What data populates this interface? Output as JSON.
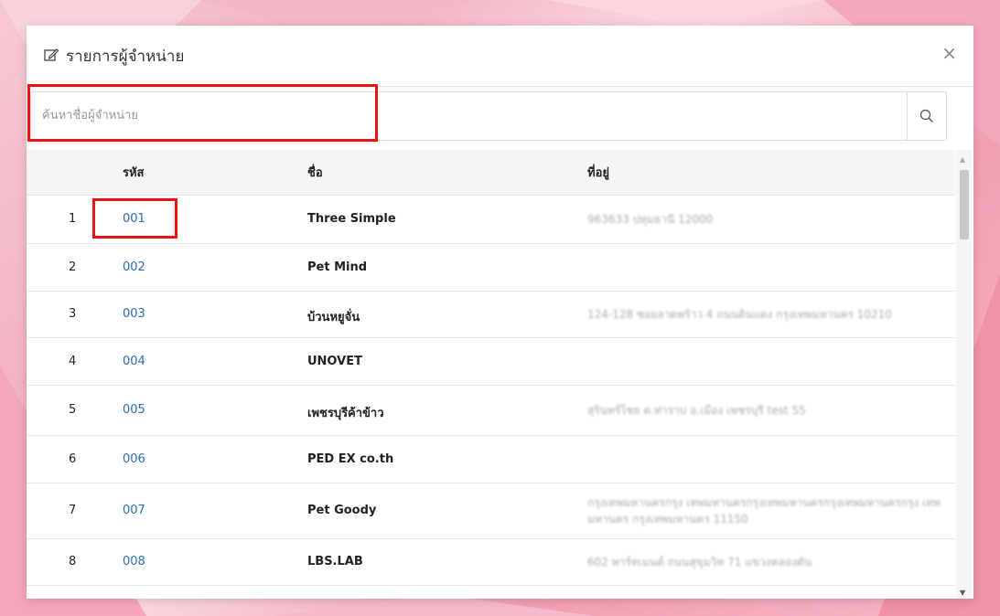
{
  "dialog": {
    "title": "รายการผู้จำหน่าย",
    "close_label": "×"
  },
  "search": {
    "placeholder": "ค้นหาชื่อผู้จำหน่าย",
    "value": ""
  },
  "table": {
    "headers": {
      "code": "รหัส",
      "name": "ชื่อ",
      "address": "ที่อยู่"
    },
    "rows": [
      {
        "num": "1",
        "code": "001",
        "name": "Three Simple",
        "address": "963633 ปทุมธานี 12000"
      },
      {
        "num": "2",
        "code": "002",
        "name": "Pet Mind",
        "address": ""
      },
      {
        "num": "3",
        "code": "003",
        "name": "บ้วนหยูจั่น",
        "address": "124-128 ซอยลาดพร้าว 4 ถนนดินแดง กรุงเทพมหานคร 10210"
      },
      {
        "num": "4",
        "code": "004",
        "name": "UNOVET",
        "address": ""
      },
      {
        "num": "5",
        "code": "005",
        "name": "เพชรบุรีค้าข้าว",
        "address": "สุรินทร์ไชย ต.ท่าราบ อ.เมือง เพชรบุรี test 55"
      },
      {
        "num": "6",
        "code": "006",
        "name": "PED EX co.th",
        "address": ""
      },
      {
        "num": "7",
        "code": "007",
        "name": "Pet Goody",
        "address": "กรุงเทพมหานครกรุง เทพมหานครกรุงเทพมหานครกรุงเทพมหานครกรุง เทพมหานคร กรุงเทพมหานคร 11150"
      },
      {
        "num": "8",
        "code": "008",
        "name": "LBS.LAB",
        "address": "602 พาร์ทเมนต์ ถนนสุขุมวิท 71 แขวงคลองตัน"
      }
    ]
  },
  "colors": {
    "link": "#2a6db3",
    "highlight": "#ee1111"
  }
}
